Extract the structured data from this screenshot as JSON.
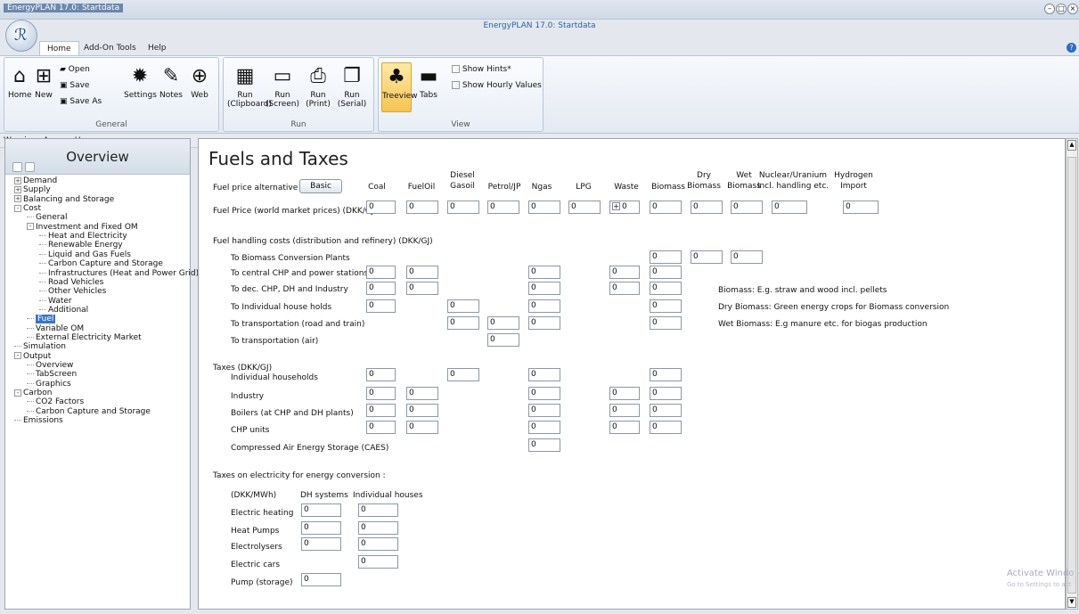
{
  "window": {
    "title": "EnergyPLAN 17.0: Startdata",
    "corner_title": "EnergyPLAN 17.0: Startdata"
  },
  "menu_tabs": [
    "Home",
    "Add-On Tools",
    "Help"
  ],
  "ribbon": {
    "general": {
      "label": "General",
      "home": "Home",
      "new": "New",
      "open": "Open",
      "save": "Save",
      "save_as": "Save As",
      "settings": "Settings",
      "notes": "Notes",
      "web": "Web"
    },
    "run": {
      "label": "Run",
      "clipboard": "Run\n(Clipboard)",
      "screen": "Run\n(Screen)",
      "print": "Run\n(Print)",
      "serial": "Run\n(Serial)"
    },
    "view": {
      "label": "View",
      "treeview": "Treeview",
      "tabs": "Tabs",
      "show_hints": "Show Hints*",
      "show_hourly": "Show Hourly Values"
    }
  },
  "warnings": "Warnings Appear Here:",
  "overview": {
    "title": "Overview",
    "tree": [
      {
        "label": "Demand",
        "lvl": 0,
        "pm": "+"
      },
      {
        "label": "Supply",
        "lvl": 0,
        "pm": "+"
      },
      {
        "label": "Balancing and Storage",
        "lvl": 0,
        "pm": "+"
      },
      {
        "label": "Cost",
        "lvl": 0,
        "pm": "-"
      },
      {
        "label": "General",
        "lvl": 1
      },
      {
        "label": "Investment and Fixed OM",
        "lvl": 1,
        "pm": "-"
      },
      {
        "label": "Heat and Electricity",
        "lvl": 2
      },
      {
        "label": "Renewable Energy",
        "lvl": 2
      },
      {
        "label": "Liquid and Gas Fuels",
        "lvl": 2
      },
      {
        "label": "Carbon Capture and Storage",
        "lvl": 2
      },
      {
        "label": "Infrastructures (Heat and Power Grid)",
        "lvl": 2
      },
      {
        "label": "Road Vehicles",
        "lvl": 2
      },
      {
        "label": "Other Vehicles",
        "lvl": 2
      },
      {
        "label": "Water",
        "lvl": 2
      },
      {
        "label": "Additional",
        "lvl": 2
      },
      {
        "label": "Fuel",
        "lvl": 1,
        "sel": true
      },
      {
        "label": "Variable OM",
        "lvl": 1
      },
      {
        "label": "External Electricity Market",
        "lvl": 1
      },
      {
        "label": "Simulation",
        "lvl": 0
      },
      {
        "label": "Output",
        "lvl": 0,
        "pm": "-"
      },
      {
        "label": "Overview",
        "lvl": 1
      },
      {
        "label": "TabScreen",
        "lvl": 1
      },
      {
        "label": "Graphics",
        "lvl": 1
      },
      {
        "label": "Carbon",
        "lvl": 0,
        "pm": "-"
      },
      {
        "label": "CO2 Factors",
        "lvl": 1
      },
      {
        "label": "Carbon Capture and Storage",
        "lvl": 1
      },
      {
        "label": "Emissions",
        "lvl": 0
      }
    ]
  },
  "page": {
    "title": "Fuels and Taxes",
    "fuel_price_alt_label": "Fuel price alternative :",
    "basic_button": "Basic",
    "fuel_price_label": "Fuel Price (world market prices) (DKK/GJ)",
    "handling_label": "Fuel handling costs (distribution and  refinery) (DKK/GJ)",
    "taxes_label": "Taxes  (DKK/GJ)",
    "elec_taxes_label": "Taxes on electricity for energy conversion :",
    "elec_unit": "(DKK/MWh)",
    "dh_systems": "DH systems",
    "individual_houses": "Individual houses",
    "stepper": "+",
    "columns": [
      {
        "l1": "",
        "l2": "Coal"
      },
      {
        "l1": "",
        "l2": "FuelOil"
      },
      {
        "l1": "Diesel",
        "l2": "Gasoil"
      },
      {
        "l1": "",
        "l2": "Petrol/JP"
      },
      {
        "l1": "",
        "l2": "Ngas"
      },
      {
        "l1": "",
        "l2": "LPG"
      },
      {
        "l1": "",
        "l2": "Waste"
      },
      {
        "l1": "",
        "l2": "Biomass"
      },
      {
        "l1": "Dry",
        "l2": "Biomass"
      },
      {
        "l1": "Wet",
        "l2": "Biomass"
      },
      {
        "l1": "Nuclear/Uranium",
        "l2": "Incl. handling etc."
      },
      {
        "l1": "Hydrogen",
        "l2": "Import"
      }
    ],
    "handling_rows": [
      "To Biomass Conversion Plants",
      "To central CHP and power stations",
      "To dec. CHP, DH and Industry",
      "To Individual house holds",
      "To transportation (road and train)",
      "To transportation (air)"
    ],
    "tax_rows": [
      "Individual households",
      "Industry",
      "Boilers (at CHP and DH plants)",
      "CHP units",
      "Compressed Air Energy Storage (CAES)"
    ],
    "elec_rows": [
      "Electric heating",
      "Heat Pumps",
      "Electrolysers",
      "Electric cars",
      "Pump (storage)"
    ],
    "notes": [
      "Biomass: E.g. straw and wood incl. pellets",
      "Dry Biomass: Green energy crops for Biomass conversion",
      "Wet Biomass: E.g manure etc. for biogas production"
    ],
    "value": "0"
  },
  "watermark": {
    "line1": "Activate Windo",
    "line2": "Go to Settings to act"
  }
}
